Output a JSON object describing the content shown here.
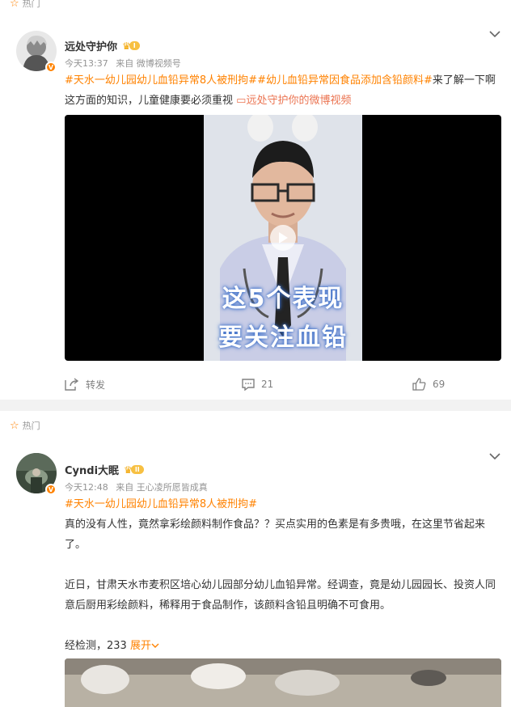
{
  "post1": {
    "hot_label": "热门",
    "username": "远处守护你",
    "vip_level": "I",
    "time": "今天13:37",
    "source": "来自 微博视频号",
    "topic1": "#天水一幼儿园幼儿血铅异常8人被刑拘#",
    "topic2": "#幼儿血铅异常因食品添加含铅颜料#",
    "text_rest": "来了解一下啊这方面的知识，儿童健康要必须重视",
    "link_text": "远处守护你的微博视频",
    "video": {
      "caption_line1": "这5个表现",
      "caption_line2": "要关注血铅"
    },
    "actions": {
      "repost_label": "转发",
      "comment_count": "21",
      "like_count": "69"
    }
  },
  "post2": {
    "hot_label": "热门",
    "username": "Cyndi大眠",
    "vip_level": "II",
    "time": "今天12:48",
    "source": "来自 王心凌所愿皆成真",
    "topic1": "#天水一幼儿园幼儿血铅异常8人被刑拘#",
    "para1": "真的没有人性，竟然拿彩绘颜料制作食品？？买点实用的色素是有多贵哦，在这里节省起来了。",
    "para2": "近日，甘肃天水市麦积区培心幼儿园部分幼儿血铅异常。经调查，竟是幼儿园园长、投资人同意后厨用彩绘颜料，稀释用于食品制作，该颜料含铅且明确不可食用。",
    "para3": "经检测，233",
    "expand_label": "展开"
  },
  "colors": {
    "accent": "#ff8200",
    "link": "#eb7350",
    "text": "#333333",
    "muted": "#939393",
    "divider": "#f2f2f2"
  },
  "icons": [
    "hot-star-icon",
    "chevron-down-icon",
    "repost-icon",
    "comment-icon",
    "like-icon",
    "play-icon",
    "video-link-icon",
    "vip-crown-icon"
  ]
}
